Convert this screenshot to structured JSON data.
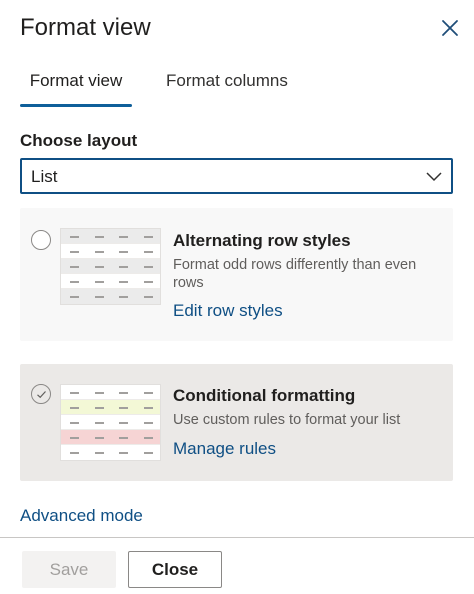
{
  "panel": {
    "title": "Format view"
  },
  "tabs": [
    {
      "label": "Format view",
      "active": true
    },
    {
      "label": "Format columns",
      "active": false
    }
  ],
  "layout": {
    "label": "Choose layout",
    "selected": "List"
  },
  "cards": [
    {
      "title": "Alternating row styles",
      "description": "Format odd rows differently than even rows",
      "link": "Edit row styles",
      "selected": false
    },
    {
      "title": "Conditional formatting",
      "description": "Use custom rules to format your list",
      "link": "Manage rules",
      "selected": true
    }
  ],
  "advanced_link": "Advanced mode",
  "footer": {
    "save_label": "Save",
    "close_label": "Close"
  },
  "colors": {
    "accent": "#0f4f84",
    "alt_row": "#ebebeb",
    "highlight_yellow": "#f3f8d6",
    "highlight_red": "#f6d4d4"
  }
}
